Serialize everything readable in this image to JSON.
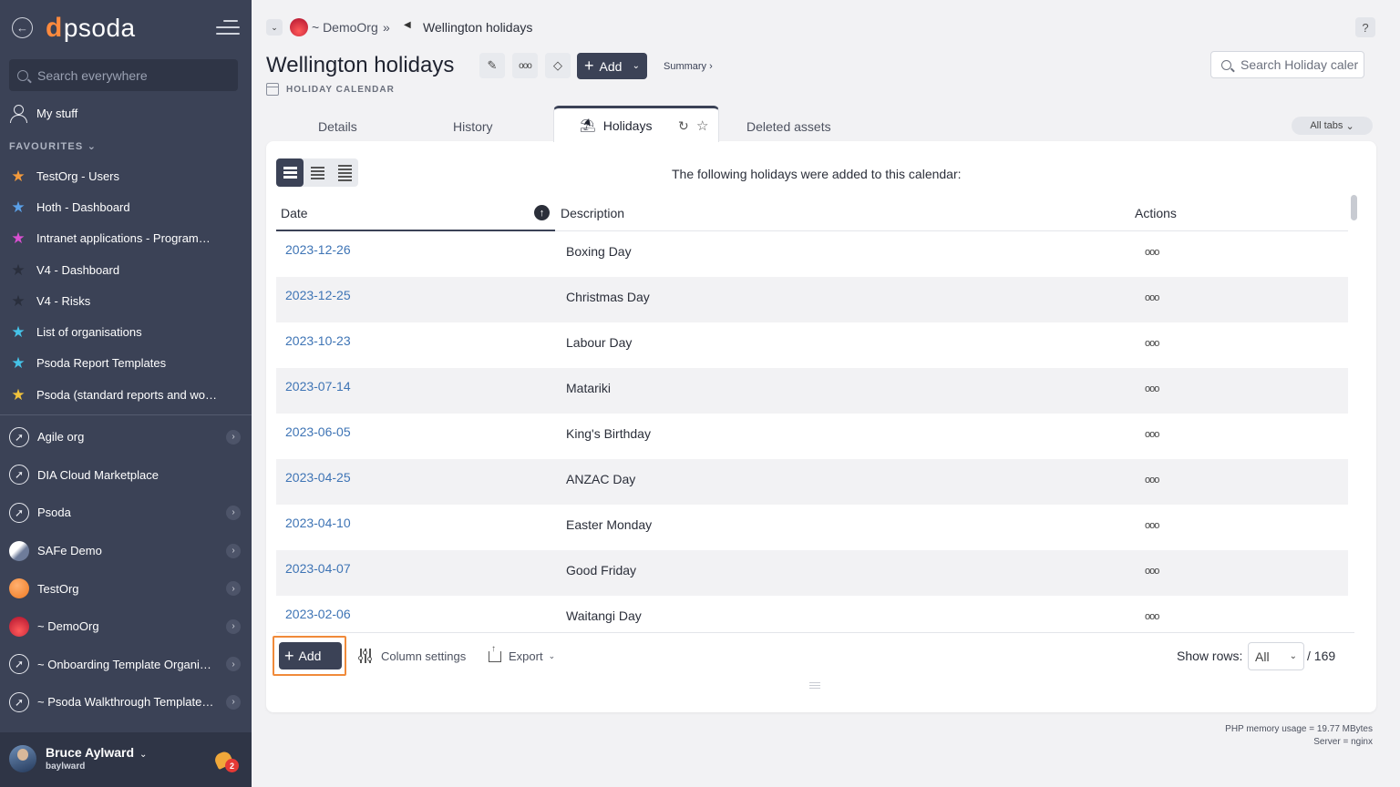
{
  "sidebar": {
    "logo": "psoda",
    "search_placeholder": "Search everywhere",
    "my_stuff": "My stuff",
    "favourites_heading": "FAVOURITES",
    "favourites": [
      {
        "label": "TestOrg - Users",
        "color": "#f39a3c"
      },
      {
        "label": "Hoth - Dashboard",
        "color": "#5aa0e8"
      },
      {
        "label": "Intranet applications - Programme...",
        "color": "#d94fd1"
      },
      {
        "label": "V4 - Dashboard",
        "color": "#2a2f3d"
      },
      {
        "label": "V4 - Risks",
        "color": "#2a2f3d"
      },
      {
        "label": "List of organisations",
        "color": "#45c3e8"
      },
      {
        "label": "Psoda Report Templates",
        "color": "#45c3e8"
      },
      {
        "label": "Psoda (standard reports and work...",
        "color": "#f0c23c"
      }
    ],
    "organisations": [
      {
        "label": "Agile org",
        "icon": "compass",
        "has_chevron": true
      },
      {
        "label": "DIA Cloud Marketplace",
        "icon": "compass",
        "has_chevron": false
      },
      {
        "label": "Psoda",
        "icon": "compass",
        "has_chevron": true
      },
      {
        "label": "SAFe Demo",
        "icon": "safe",
        "has_chevron": true
      },
      {
        "label": "TestOrg",
        "icon": "testorg",
        "has_chevron": true
      },
      {
        "label": "~ DemoOrg",
        "icon": "demoorg",
        "has_chevron": true
      },
      {
        "label": "~ Onboarding Template Organisa...",
        "icon": "compass",
        "has_chevron": true
      },
      {
        "label": "~ Psoda Walkthrough Template P...",
        "icon": "compass",
        "has_chevron": true
      }
    ],
    "user": {
      "name": "Bruce Aylward",
      "login": "baylward",
      "notifications": "2"
    }
  },
  "breadcrumb": {
    "org": "~ DemoOrg",
    "separator": "»",
    "current": "Wellington holidays"
  },
  "header": {
    "title": "Wellington holidays",
    "subtitle": "HOLIDAY CALENDAR",
    "add_label": "Add",
    "summary_link": "Summary ›",
    "search_placeholder": "Search Holiday caler",
    "help": "?"
  },
  "tabs": {
    "details": "Details",
    "history": "History",
    "holidays": "Holidays",
    "deleted_assets": "Deleted assets",
    "all_tabs": "All tabs"
  },
  "table": {
    "intro": "The following holidays were added to this calendar:",
    "columns": {
      "date": "Date",
      "description": "Description",
      "actions": "Actions"
    },
    "action_glyph": "ooo",
    "rows": [
      {
        "date": "2023-12-26",
        "description": "Boxing Day"
      },
      {
        "date": "2023-12-25",
        "description": "Christmas Day"
      },
      {
        "date": "2023-10-23",
        "description": "Labour Day"
      },
      {
        "date": "2023-07-14",
        "description": "Matariki"
      },
      {
        "date": "2023-06-05",
        "description": "King's Birthday"
      },
      {
        "date": "2023-04-25",
        "description": "ANZAC Day"
      },
      {
        "date": "2023-04-10",
        "description": "Easter Monday"
      },
      {
        "date": "2023-04-07",
        "description": "Good Friday"
      },
      {
        "date": "2023-02-06",
        "description": "Waitangi Day"
      }
    ]
  },
  "footer": {
    "add_label": "Add",
    "column_settings": "Column settings",
    "export": "Export",
    "show_rows_label": "Show rows:",
    "show_rows_value": "All",
    "total": "/ 169"
  },
  "server_info": {
    "memory": "PHP memory usage = 19.77 MBytes",
    "server": "Server = nginx"
  },
  "colors": {
    "sidebar": "#3b4256",
    "accent_link": "#3e74b5",
    "highlight": "#f08a3a"
  }
}
